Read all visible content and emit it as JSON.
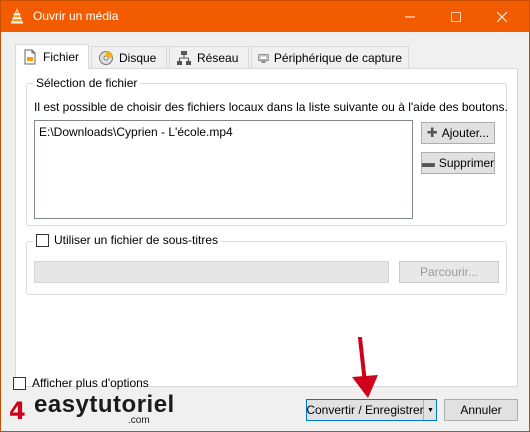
{
  "window": {
    "title": "Ouvrir un média",
    "controls": {
      "minimize": "—",
      "maximize": "☐",
      "close": "✕"
    }
  },
  "tabs": [
    {
      "label": "Fichier",
      "icon": "file-icon",
      "active": true
    },
    {
      "label": "Disque",
      "icon": "disc-icon",
      "active": false
    },
    {
      "label": "Réseau",
      "icon": "network-icon",
      "active": false
    },
    {
      "label": "Périphérique de capture",
      "icon": "capture-device-icon",
      "active": false
    }
  ],
  "file_selection": {
    "legend": "Sélection de fichier",
    "description": "Il est possible de choisir des fichiers locaux dans la liste suivante ou à l'aide des boutons.",
    "files": [
      "E:\\Downloads\\Cyprien - L'école.mp4"
    ],
    "add_label": "Ajouter...",
    "remove_label": "Supprimer"
  },
  "subtitles": {
    "checkbox_label": "Utiliser un fichier de sous-titres",
    "checked": false,
    "path_value": "",
    "browse_label": "Parcourir..."
  },
  "footer": {
    "more_options_label": "Afficher plus d'options",
    "convert_label": "Convertir / Enregistrer",
    "dropdown_glyph": "▼",
    "cancel_label": "Annuler"
  },
  "watermark": {
    "text": "easytutoriel",
    "sub": ".com"
  },
  "colors": {
    "titlebar": "#f35b00",
    "arrow": "#d0021b",
    "focus_border": "#0078d7"
  }
}
